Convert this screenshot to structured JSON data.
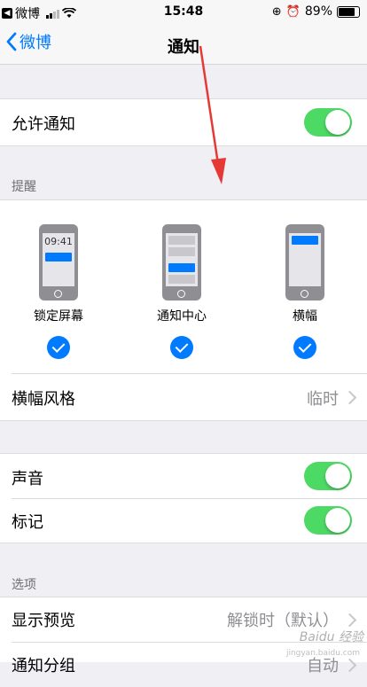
{
  "status": {
    "back_app": "微博",
    "time": "15:48",
    "battery": "89%",
    "battery_level": 0.89
  },
  "nav": {
    "back_label": "微博",
    "title": "通知"
  },
  "allow": {
    "label": "允许通知",
    "enabled": true
  },
  "alerts": {
    "header": "提醒",
    "styles": [
      {
        "label": "锁定屏幕",
        "time": "09:41",
        "checked": true
      },
      {
        "label": "通知中心",
        "checked": true
      },
      {
        "label": "横幅",
        "checked": true
      }
    ],
    "banner_style": {
      "label": "横幅风格",
      "value": "临时"
    }
  },
  "sounds": {
    "label": "声音",
    "enabled": true
  },
  "badges": {
    "label": "标记",
    "enabled": true
  },
  "options": {
    "header": "选项",
    "show_previews": {
      "label": "显示预览",
      "value": "解锁时（默认）"
    },
    "grouping": {
      "label": "通知分组",
      "value": "自动"
    }
  },
  "watermark": {
    "text": "Baidu 经验",
    "sub": "jingyan.baidu.com"
  },
  "colors": {
    "accent": "#007aff",
    "toggle_on": "#4cd964",
    "annotation_arrow": "#e53935"
  }
}
